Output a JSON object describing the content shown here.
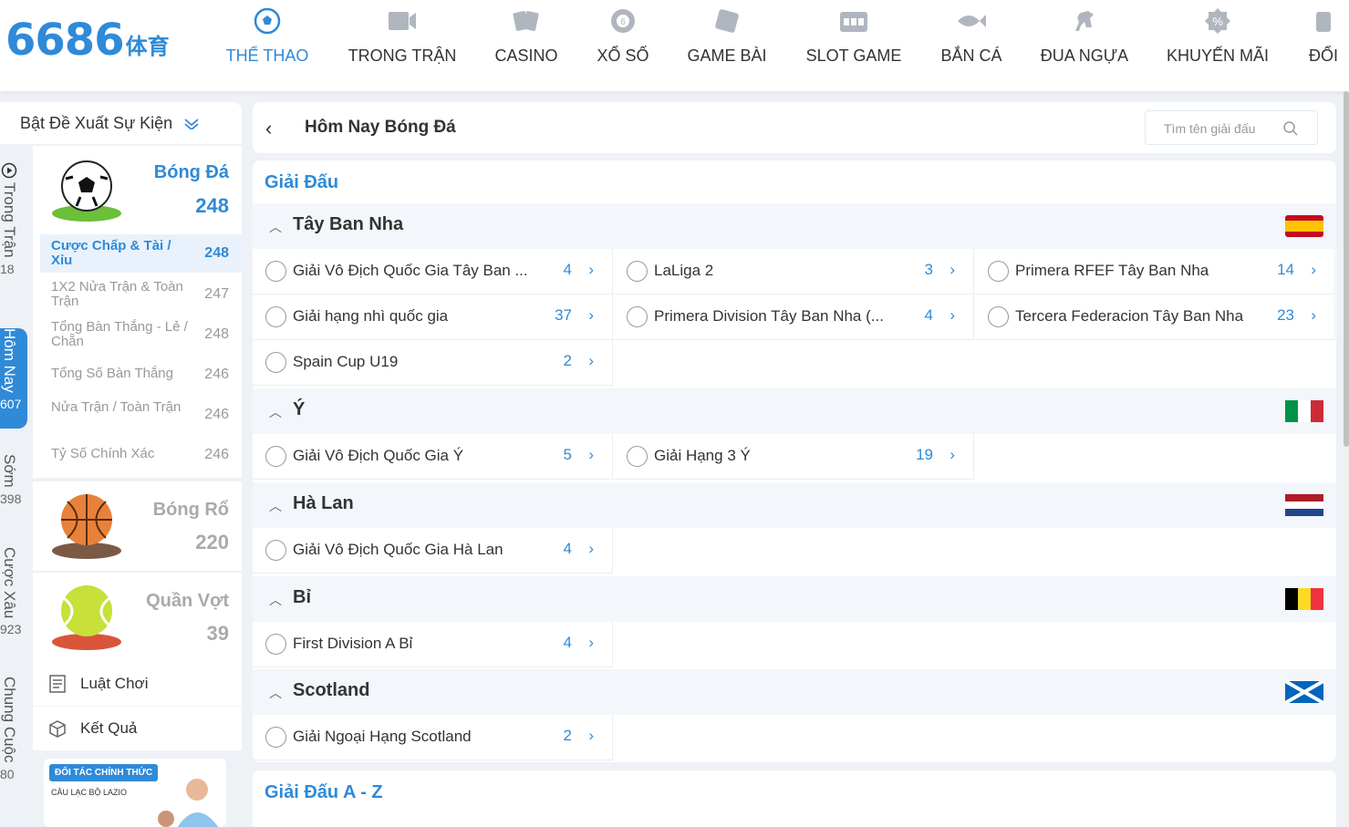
{
  "logo": {
    "number": "6686",
    "suffix": "体育"
  },
  "nav": [
    {
      "label": "THỂ THAO",
      "icon": "soccer-ball-icon",
      "active": true
    },
    {
      "label": "TRONG TRẬN",
      "icon": "live-video-icon"
    },
    {
      "label": "CASINO",
      "icon": "cards-icon"
    },
    {
      "label": "XỔ SỐ",
      "icon": "lottery-ball-icon"
    },
    {
      "label": "GAME BÀI",
      "icon": "card-game-icon"
    },
    {
      "label": "SLOT GAME",
      "icon": "slot-machine-icon"
    },
    {
      "label": "BẮN CÁ",
      "icon": "fish-icon"
    },
    {
      "label": "ĐUA NGỰA",
      "icon": "horse-icon"
    },
    {
      "label": "KHUYẾN MÃI",
      "icon": "promo-icon"
    },
    {
      "label": "ĐỔI",
      "icon": "exchange-icon"
    }
  ],
  "sidebar": {
    "header": "Bật Đề Xuất Sự Kiện",
    "vtabs": [
      {
        "label": "Trong Trận",
        "count": "18"
      },
      {
        "label": "Hôm Nay",
        "count": "607",
        "active": true
      },
      {
        "label": "Sớm",
        "count": "398"
      },
      {
        "label": "Cược Xâu",
        "count": "923"
      },
      {
        "label": "Chung Cuộc",
        "count": "80"
      }
    ],
    "sports": [
      {
        "name": "Bóng Đá",
        "count": "248",
        "icon": "soccer-icon",
        "active": true
      },
      {
        "name": "Bóng Rổ",
        "count": "220",
        "icon": "basketball-icon"
      },
      {
        "name": "Quần Vợt",
        "count": "39",
        "icon": "tennis-icon"
      }
    ],
    "subs": [
      {
        "label": "Cược Chấp & Tài / Xỉu",
        "count": "248",
        "active": true
      },
      {
        "label": "1X2 Nửa Trận & Toàn Trận",
        "count": "247"
      },
      {
        "label": "Tổng Bàn Thắng - Lẻ / Chẵn",
        "count": "248"
      },
      {
        "label": "Tổng Số Bàn Thắng",
        "count": "246"
      },
      {
        "label": "Nửa Trận / Toàn Trận",
        "count": "246"
      },
      {
        "label": "Tỷ Số Chính Xác",
        "count": "246"
      }
    ],
    "utils": [
      {
        "label": "Luật Chơi",
        "icon": "rules-icon"
      },
      {
        "label": "Kết Quả",
        "icon": "results-box-icon"
      }
    ],
    "banner": {
      "tag": "ĐỐI TÁC CHÍNH THỨC",
      "club": "CÂU LẠC BỘ LAZIO"
    }
  },
  "main": {
    "title": "Hôm Nay Bóng Đá",
    "search_placeholder": "Tìm tên giải đấu",
    "section_title": "Giải Đấu",
    "az_title": "Giải Đấu A - Z",
    "countries": [
      {
        "name": "Tây Ban Nha",
        "flag": "spain",
        "leagues": [
          {
            "name": "Giải Vô Địch Quốc Gia Tây Ban ...",
            "count": "4"
          },
          {
            "name": "LaLiga 2",
            "count": "3"
          },
          {
            "name": "Primera RFEF Tây Ban Nha",
            "count": "14"
          },
          {
            "name": "Giải hạng nhì quốc gia",
            "count": "37"
          },
          {
            "name": "Primera Division Tây Ban Nha (...",
            "count": "4"
          },
          {
            "name": "Tercera Federacion Tây Ban Nha",
            "count": "23"
          },
          {
            "name": "Spain Cup U19",
            "count": "2"
          }
        ]
      },
      {
        "name": "Ý",
        "flag": "italy",
        "leagues": [
          {
            "name": "Giải Vô Địch Quốc Gia Ý",
            "count": "5"
          },
          {
            "name": "Giải Hạng 3 Ý",
            "count": "19"
          }
        ]
      },
      {
        "name": "Hà Lan",
        "flag": "netherlands",
        "leagues": [
          {
            "name": "Giải Vô Địch Quốc Gia Hà Lan",
            "count": "4"
          }
        ]
      },
      {
        "name": "Bỉ",
        "flag": "belgium",
        "leagues": [
          {
            "name": "First Division A Bỉ",
            "count": "4"
          }
        ]
      },
      {
        "name": "Scotland",
        "flag": "scotland",
        "leagues": [
          {
            "name": "Giải Ngoại Hạng Scotland",
            "count": "2"
          }
        ]
      }
    ]
  },
  "colors": {
    "accent": "#2f8ad8",
    "muted": "#aaaaaa"
  }
}
